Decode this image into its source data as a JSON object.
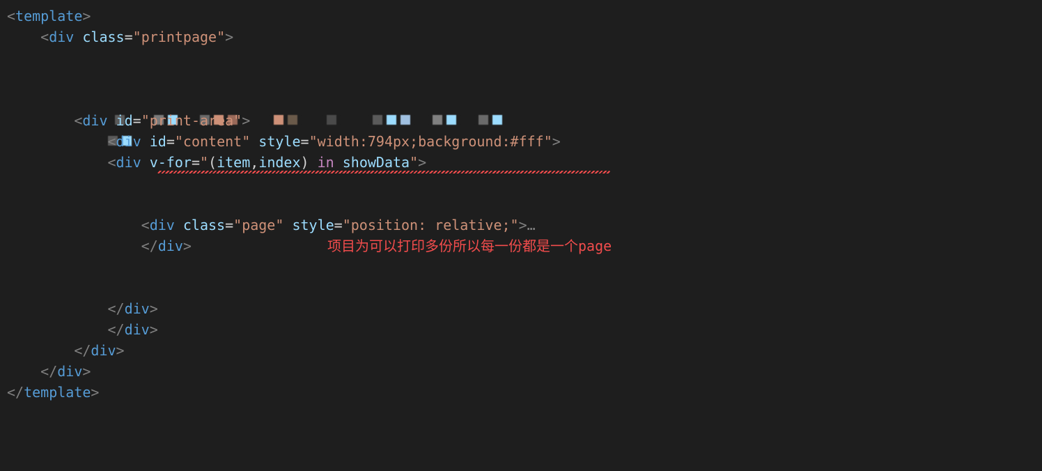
{
  "code": {
    "line1": {
      "open_angle": "<",
      "tag": "template",
      "close_angle": ">"
    },
    "line2": {
      "open_angle": "<",
      "tag": "div",
      "attr": "class",
      "eq": "=",
      "quote_open": "\"",
      "value": "printpage",
      "quote_close": "\"",
      "close_angle": ">"
    },
    "line3": {
      "open_angle": "<",
      "tag": "div",
      "attr": "id",
      "eq": "=",
      "quote_open": "\"",
      "value": "print-area",
      "quote_close": "\"",
      "close_angle": ">"
    },
    "line4": {
      "open_angle": "<",
      "tag": "div",
      "attr1": "id",
      "eq": "=",
      "value1": "content",
      "attr2": "style",
      "value2": "width:794px;background:#fff",
      "close_angle": ">"
    },
    "line5": {
      "open_angle": "<",
      "tag": "div",
      "attr": "v-for",
      "eq": "=",
      "quote": "\"",
      "paren_open": "(",
      "var1": "item",
      "comma": ",",
      "var2": "index",
      "paren_close": ")",
      "kw": "in",
      "var3": "showData",
      "close_angle": ">"
    },
    "line6": {
      "open_angle": "<",
      "tag": "div",
      "attr1": "class",
      "eq": "=",
      "value1": "page",
      "attr2": "style",
      "value2": "position: relative;",
      "close_angle": ">",
      "fold": "…"
    },
    "line7": {
      "open_angle": "</",
      "tag": "div",
      "close_angle": ">"
    },
    "line8": {
      "open_angle": "</",
      "tag": "div",
      "close_angle": ">"
    },
    "line9": {
      "open_angle": "</",
      "tag": "div",
      "close_angle": ">"
    },
    "line10": {
      "open_angle": "</",
      "tag": "div",
      "close_angle": ">"
    },
    "line11": {
      "open_angle": "</",
      "tag": "div",
      "close_angle": ">"
    },
    "line12": {
      "open_angle": "</",
      "tag": "template",
      "close_angle": ">"
    }
  },
  "annotation": "项目为可以打印多份所以每一份都是一个page"
}
